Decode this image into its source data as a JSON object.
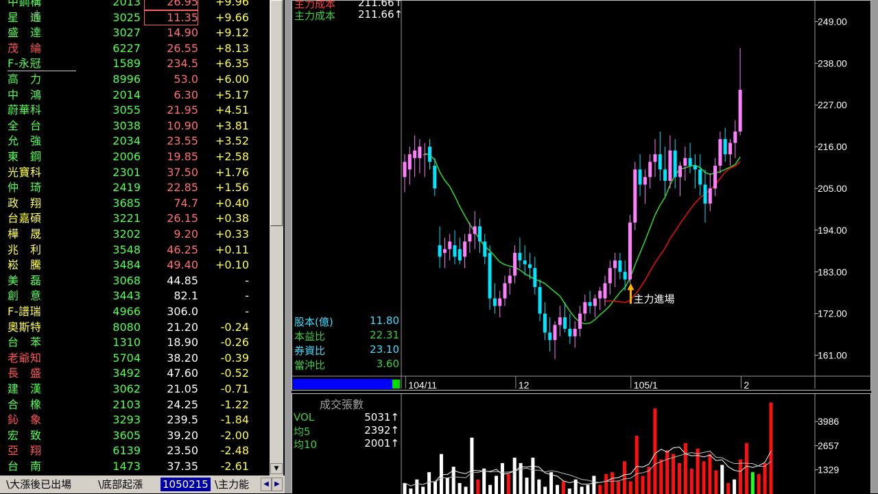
{
  "stock_list": [
    {
      "name": "中鋼構",
      "code": "2013",
      "price": "26.95",
      "change": "+9.96",
      "name_color": "g",
      "price_color": "lr",
      "price_boxed": true
    },
    {
      "name": "星　通",
      "code": "3025",
      "price": "11.35",
      "change": "+9.66",
      "name_color": "g",
      "price_color": "lr",
      "price_boxed": true
    },
    {
      "name": "盛　達",
      "code": "3027",
      "price": "14.90",
      "change": "+9.12",
      "name_color": "g",
      "price_color": "lr"
    },
    {
      "name": "茂　綸",
      "code": "6227",
      "price": "26.55",
      "change": "+8.13",
      "name_color": "r",
      "price_color": "lr"
    },
    {
      "name": "F-永冠",
      "code": "1589",
      "price": "234.5",
      "change": "+6.35",
      "name_color": "g",
      "price_color": "lr",
      "underline": true
    },
    {
      "name": "高　力",
      "code": "8996",
      "price": "53.0",
      "change": "+6.00",
      "name_color": "g",
      "price_color": "lr"
    },
    {
      "name": "中　鴻",
      "code": "2014",
      "price": "6.30",
      "change": "+5.17",
      "name_color": "g",
      "price_color": "lr"
    },
    {
      "name": "蔚華科",
      "code": "3055",
      "price": "21.95",
      "change": "+4.51",
      "name_color": "g",
      "price_color": "lr"
    },
    {
      "name": "全　台",
      "code": "3038",
      "price": "10.90",
      "change": "+3.81",
      "name_color": "g",
      "price_color": "lr"
    },
    {
      "name": "允　強",
      "code": "2034",
      "price": "23.55",
      "change": "+3.52",
      "name_color": "g",
      "price_color": "lr"
    },
    {
      "name": "東　鋼",
      "code": "2006",
      "price": "19.85",
      "change": "+2.58",
      "name_color": "g",
      "price_color": "lr"
    },
    {
      "name": "光寶科",
      "code": "2301",
      "price": "37.50",
      "change": "+1.76",
      "name_color": "y",
      "price_color": "lr"
    },
    {
      "name": "仲　琦",
      "code": "2419",
      "price": "22.85",
      "change": "+1.56",
      "name_color": "g",
      "price_color": "lr"
    },
    {
      "name": "政　翔",
      "code": "3685",
      "price": "74.7",
      "change": "+0.40",
      "name_color": "y",
      "price_color": "lr"
    },
    {
      "name": "台嘉碩",
      "code": "3221",
      "price": "26.15",
      "change": "+0.38",
      "name_color": "y",
      "price_color": "lr"
    },
    {
      "name": "樺　晟",
      "code": "3202",
      "price": "9.20",
      "change": "+0.33",
      "name_color": "y",
      "price_color": "lr"
    },
    {
      "name": "兆　利",
      "code": "3548",
      "price": "46.25",
      "change": "+0.11",
      "name_color": "y",
      "price_color": "lr"
    },
    {
      "name": "崧　騰",
      "code": "3484",
      "price": "49.40",
      "change": "+0.10",
      "name_color": "y",
      "price_color": "lr"
    },
    {
      "name": "美　磊",
      "code": "3068",
      "price": "44.85",
      "change": "-",
      "name_color": "g",
      "price_color": "w"
    },
    {
      "name": "創　意",
      "code": "3443",
      "price": "82.1",
      "change": "-",
      "name_color": "g",
      "price_color": "w"
    },
    {
      "name": "F-譜瑞",
      "code": "4966",
      "price": "306.0",
      "change": "-",
      "name_color": "y",
      "price_color": "w"
    },
    {
      "name": "奧斯特",
      "code": "8080",
      "price": "21.20",
      "change": "-0.24",
      "name_color": "y",
      "price_color": "w"
    },
    {
      "name": "台　苯",
      "code": "1310",
      "price": "18.90",
      "change": "-0.26",
      "name_color": "g",
      "price_color": "w"
    },
    {
      "name": "老爺知",
      "code": "5704",
      "price": "38.20",
      "change": "-0.39",
      "name_color": "r",
      "price_color": "w"
    },
    {
      "name": "長　盛",
      "code": "3492",
      "price": "47.60",
      "change": "-0.52",
      "name_color": "r",
      "price_color": "w"
    },
    {
      "name": "建　漢",
      "code": "3062",
      "price": "21.05",
      "change": "-0.71",
      "name_color": "g",
      "price_color": "w"
    },
    {
      "name": "合　橡",
      "code": "2103",
      "price": "24.25",
      "change": "-1.22",
      "name_color": "g",
      "price_color": "w"
    },
    {
      "name": "鈊　象",
      "code": "3293",
      "price": "239.5",
      "change": "-1.84",
      "name_color": "r",
      "price_color": "w"
    },
    {
      "name": "宏　致",
      "code": "3605",
      "price": "39.20",
      "change": "-2.00",
      "name_color": "g",
      "price_color": "w"
    },
    {
      "name": "亞　翔",
      "code": "6139",
      "price": "23.50",
      "change": "-2.48",
      "name_color": "r",
      "price_color": "w"
    },
    {
      "name": "台　南",
      "code": "1473",
      "price": "37.35",
      "change": "-2.61",
      "name_color": "g",
      "price_color": "w"
    }
  ],
  "sheet_tabs": [
    "大漲後已出場",
    "底部起漲",
    "1050215",
    "主力能"
  ],
  "active_tab": 2,
  "price_chart": {
    "legend": [
      {
        "label": "主力成本",
        "value": "211.66↑"
      },
      {
        "label": "主力成本",
        "value": "211.66↑"
      }
    ],
    "y_ticks": [
      "249.00",
      "238.00",
      "227.00",
      "216.00",
      "205.00",
      "194.00",
      "183.00",
      "172.00",
      "161.00"
    ],
    "x_ticks": [
      "104/11",
      "12",
      "105/1",
      "2"
    ],
    "annotation": "主力進場",
    "stats": [
      {
        "label": "股本(億)",
        "value": "11.80"
      },
      {
        "label": "本益比",
        "value": "22.31"
      },
      {
        "label": "券資比",
        "value": "23.10"
      },
      {
        "label": "當沖比",
        "value": "3.60"
      }
    ],
    "colors": {
      "up": "#ff80ff",
      "down": "#00e5ff",
      "ma_short": "#30d030",
      "ma_long": "#e01010"
    }
  },
  "volume_chart": {
    "title": "成交張數",
    "legend": [
      {
        "label": "VOL",
        "value": "5031↑"
      },
      {
        "label": "均5",
        "value": "2392↑"
      },
      {
        "label": "均10",
        "value": "2001↑"
      }
    ],
    "y_ticks": [
      "3986",
      "2657",
      "1329"
    ]
  },
  "chart_data": {
    "type": "candlestick",
    "y_range": [
      155.5,
      254.5
    ],
    "candles": [
      [
        208,
        214,
        204,
        212
      ],
      [
        210,
        216,
        206,
        214
      ],
      [
        213,
        219,
        208,
        215
      ],
      [
        213,
        218,
        209,
        216
      ],
      [
        214,
        217,
        208,
        214
      ],
      [
        216,
        218,
        210,
        212
      ],
      [
        211,
        213,
        203,
        205
      ],
      [
        190,
        195,
        184,
        187
      ],
      [
        188,
        192,
        184,
        189
      ],
      [
        189,
        193,
        186,
        191
      ],
      [
        190,
        194,
        185,
        187
      ],
      [
        189,
        192,
        185,
        186
      ],
      [
        187,
        193,
        184,
        191
      ],
      [
        191,
        196,
        188,
        193
      ],
      [
        193,
        199,
        189,
        195
      ],
      [
        195,
        197,
        188,
        191
      ],
      [
        191,
        193,
        185,
        187
      ],
      [
        188,
        190,
        173,
        176
      ],
      [
        176,
        180,
        172,
        174
      ],
      [
        174,
        178,
        171,
        176
      ],
      [
        176,
        182,
        174,
        180
      ],
      [
        180,
        184,
        177,
        182
      ],
      [
        182,
        190,
        180,
        188
      ],
      [
        188,
        192,
        184,
        186
      ],
      [
        186,
        190,
        182,
        185
      ],
      [
        185,
        188,
        181,
        184
      ],
      [
        184,
        187,
        177,
        179
      ],
      [
        179,
        181,
        170,
        172
      ],
      [
        172,
        175,
        165,
        167
      ],
      [
        167,
        171,
        162,
        165
      ],
      [
        165,
        170,
        160,
        169
      ],
      [
        169,
        174,
        166,
        171
      ],
      [
        171,
        175,
        167,
        168
      ],
      [
        168,
        172,
        164,
        166
      ],
      [
        166,
        170,
        163,
        168
      ],
      [
        168,
        174,
        166,
        172
      ],
      [
        172,
        177,
        170,
        175
      ],
      [
        175,
        178,
        172,
        174
      ],
      [
        174,
        177,
        171,
        176
      ],
      [
        176,
        179,
        173,
        178
      ],
      [
        176,
        182,
        174,
        180
      ],
      [
        180,
        186,
        177,
        184
      ],
      [
        184,
        188,
        179,
        186
      ],
      [
        186,
        188,
        181,
        183
      ],
      [
        183,
        186,
        178,
        181
      ],
      [
        181,
        198,
        180,
        196
      ],
      [
        196,
        212,
        194,
        210
      ],
      [
        210,
        214,
        203,
        206
      ],
      [
        206,
        210,
        201,
        208
      ],
      [
        208,
        214,
        205,
        212
      ],
      [
        212,
        218,
        208,
        214
      ],
      [
        214,
        220,
        207,
        210
      ],
      [
        210,
        216,
        203,
        207
      ],
      [
        207,
        219,
        205,
        215
      ],
      [
        215,
        218,
        205,
        208
      ],
      [
        208,
        212,
        203,
        211
      ],
      [
        211,
        216,
        207,
        213
      ],
      [
        213,
        217,
        209,
        211
      ],
      [
        211,
        214,
        205,
        210
      ],
      [
        210,
        214,
        203,
        206
      ],
      [
        206,
        210,
        196,
        201
      ],
      [
        201,
        209,
        199,
        205
      ],
      [
        205,
        213,
        203,
        211
      ],
      [
        211,
        220,
        209,
        218
      ],
      [
        218,
        221,
        212,
        214
      ],
      [
        214,
        218,
        211,
        217
      ],
      [
        217,
        223,
        213,
        220
      ],
      [
        220,
        242,
        219,
        231
      ]
    ],
    "x_tick_index": {
      "104/11": 1,
      "12": 23,
      "105/1": 46,
      "2": 68
    },
    "annotation_index": 45,
    "annotation_price": 180,
    "volume": [
      [
        600,
        "w"
      ],
      [
        300,
        "w"
      ],
      [
        800,
        "w"
      ],
      [
        400,
        "w"
      ],
      [
        1200,
        "w"
      ],
      [
        700,
        "w"
      ],
      [
        2200,
        "w"
      ],
      [
        900,
        "w"
      ],
      [
        1500,
        "w"
      ],
      [
        600,
        "w"
      ],
      [
        400,
        "w"
      ],
      [
        3100,
        "w"
      ],
      [
        800,
        "r"
      ],
      [
        1400,
        "w"
      ],
      [
        500,
        "w"
      ],
      [
        1000,
        "w"
      ],
      [
        1700,
        "w"
      ],
      [
        1100,
        "r"
      ],
      [
        2000,
        "w"
      ],
      [
        1700,
        "w"
      ],
      [
        900,
        "w"
      ],
      [
        2000,
        "w"
      ],
      [
        800,
        "w"
      ],
      [
        400,
        "w"
      ],
      [
        1200,
        "w"
      ],
      [
        500,
        "w"
      ],
      [
        700,
        "r"
      ],
      [
        300,
        "w"
      ],
      [
        800,
        "w"
      ],
      [
        400,
        "w"
      ],
      [
        500,
        "w"
      ],
      [
        1000,
        "w"
      ],
      [
        500,
        "r"
      ],
      [
        1100,
        "r"
      ],
      [
        1200,
        "r"
      ],
      [
        700,
        "r"
      ],
      [
        1800,
        "r"
      ],
      [
        700,
        "r"
      ],
      [
        3200,
        "r"
      ],
      [
        1000,
        "r"
      ],
      [
        1500,
        "r"
      ],
      [
        4700,
        "r"
      ],
      [
        1900,
        "r"
      ],
      [
        2400,
        "r"
      ],
      [
        2200,
        "r"
      ],
      [
        1700,
        "r"
      ],
      [
        2800,
        "r"
      ],
      [
        1400,
        "r"
      ],
      [
        2500,
        "r"
      ],
      [
        1800,
        "r"
      ],
      [
        2200,
        "r"
      ],
      [
        1300,
        "r"
      ],
      [
        1600,
        "w"
      ],
      [
        600,
        "r"
      ],
      [
        800,
        "w"
      ],
      [
        1900,
        "r"
      ],
      [
        2800,
        "r"
      ],
      [
        1200,
        "g"
      ],
      [
        1100,
        "r"
      ],
      [
        1700,
        "r"
      ],
      [
        5031,
        "r"
      ]
    ],
    "volume_range": [
      0,
      5500
    ]
  }
}
